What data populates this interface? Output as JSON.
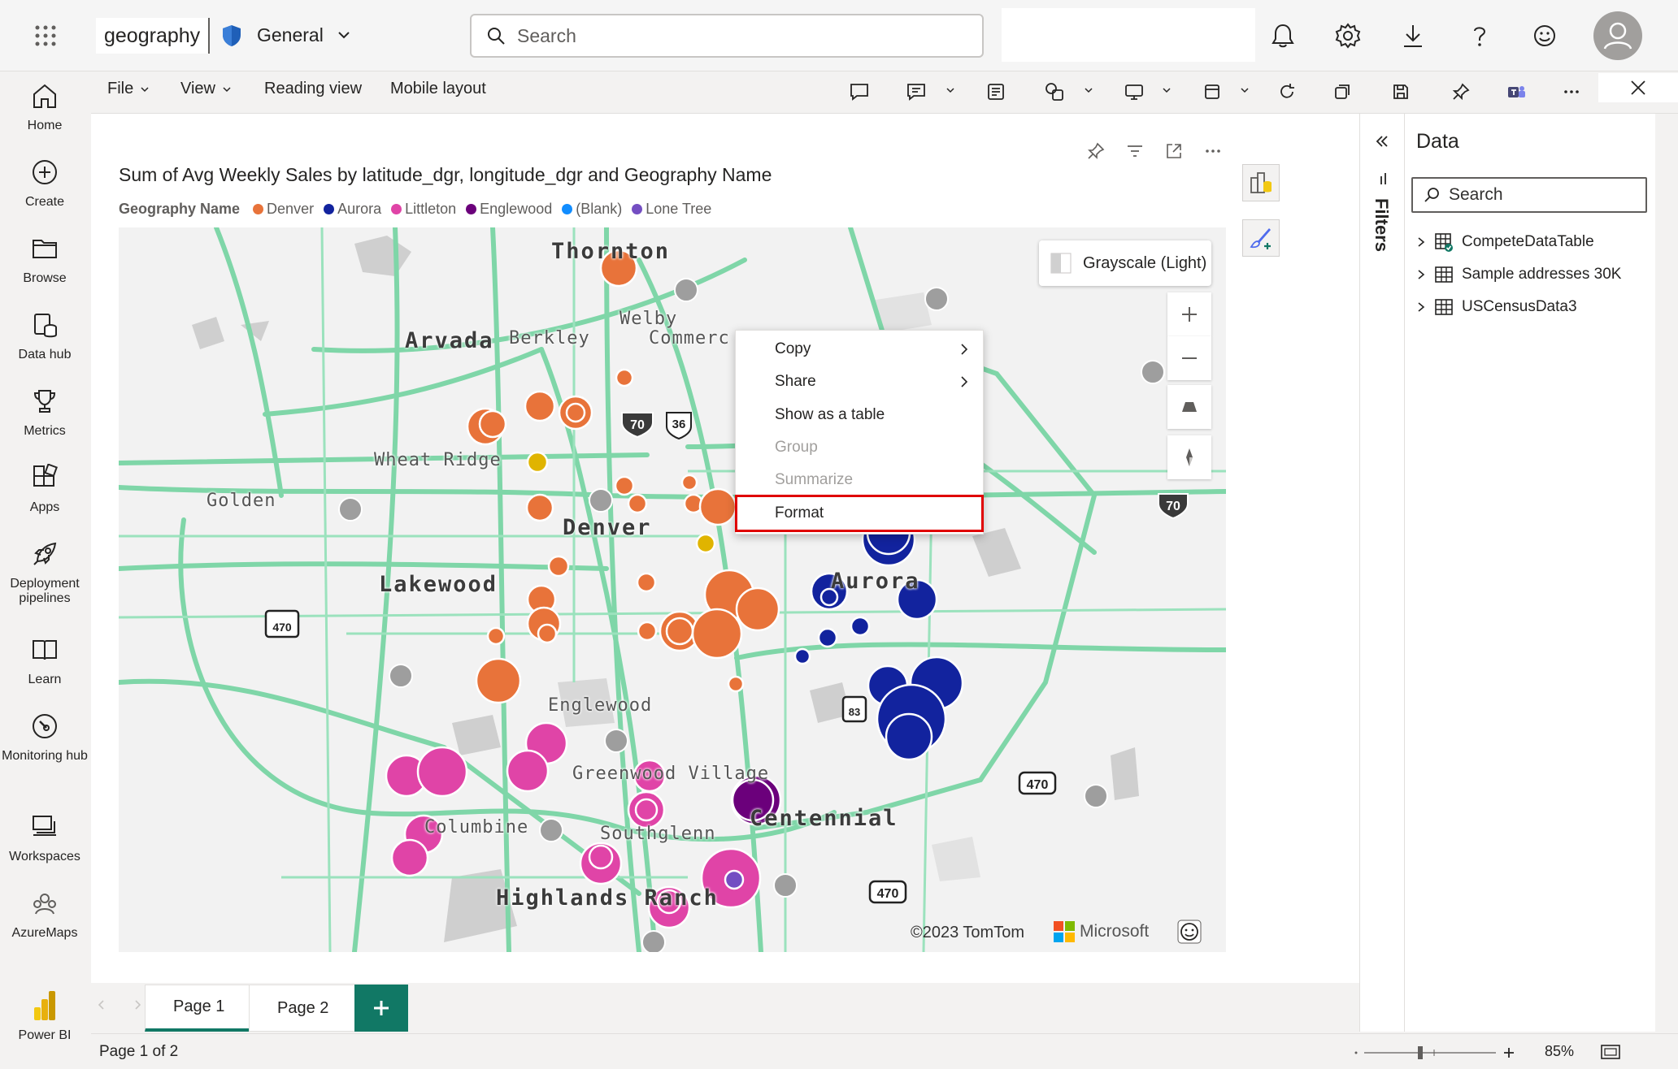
{
  "topbar": {
    "workspace_name": "geography",
    "sensitivity_label": "General",
    "search_placeholder": "Search"
  },
  "leftnav": [
    {
      "label": "Home",
      "icon": "home-icon"
    },
    {
      "label": "Create",
      "icon": "plus-circle-icon"
    },
    {
      "label": "Browse",
      "icon": "folder-icon"
    },
    {
      "label": "Data hub",
      "icon": "database-icon"
    },
    {
      "label": "Metrics",
      "icon": "trophy-icon"
    },
    {
      "label": "Apps",
      "icon": "apps-icon"
    },
    {
      "label": "Deployment pipelines",
      "icon": "rocket-icon"
    },
    {
      "label": "Learn",
      "icon": "book-icon"
    },
    {
      "label": "Monitoring hub",
      "icon": "gauge-icon"
    },
    {
      "label": "Workspaces",
      "icon": "workspaces-icon"
    },
    {
      "label": "AzureMaps",
      "icon": "azuremaps-icon"
    }
  ],
  "brand": {
    "label": "Power BI"
  },
  "ribbon": {
    "file": "File",
    "view": "View",
    "reading_view": "Reading view",
    "mobile_layout": "Mobile layout"
  },
  "visual": {
    "title": "Sum of Avg Weekly Sales by latitude_dgr, longitude_dgr and Geography Name",
    "legend_title": "Geography Name",
    "legend": [
      {
        "name": "Denver",
        "color": "#e8733a"
      },
      {
        "name": "Aurora",
        "color": "#12239e"
      },
      {
        "name": "Littleton",
        "color": "#e044a7"
      },
      {
        "name": "Englewood",
        "color": "#6b007b"
      },
      {
        "name": "(Blank)",
        "color": "#118dff"
      },
      {
        "name": "Lone Tree",
        "color": "#744ec2"
      }
    ]
  },
  "map": {
    "style_label": "Grayscale (Light)",
    "copyright": "©2023 TomTom",
    "brand": "Microsoft",
    "places": {
      "thornton": "Thornton",
      "welby": "Welby",
      "arvada": "Arvada",
      "berkley": "Berkley",
      "commerce": "Commerc",
      "wheat_ridge": "Wheat Ridge",
      "golden": "Golden",
      "denver": "Denver",
      "lakewood": "Lakewood",
      "aurora": "Aurora",
      "englewood": "Englewood",
      "greenwood": "Greenwood Village",
      "columbine": "Columbine",
      "southglenn": "Southglenn",
      "centennial": "Centennial",
      "highlands": "Highlands Ranch"
    },
    "shields": {
      "i70a": "70",
      "us36": "36",
      "i70b": "70",
      "s470a": "470",
      "s83": "83",
      "s470b": "470",
      "s470c": "470"
    }
  },
  "context_menu": {
    "items": [
      {
        "label": "Copy",
        "submenu": true,
        "disabled": false
      },
      {
        "label": "Share",
        "submenu": true,
        "disabled": false
      },
      {
        "label": "Show as a table",
        "submenu": false,
        "disabled": false
      },
      {
        "label": "Group",
        "submenu": false,
        "disabled": true
      },
      {
        "label": "Summarize",
        "submenu": false,
        "disabled": true
      },
      {
        "label": "Format",
        "submenu": false,
        "disabled": false
      }
    ]
  },
  "filters": {
    "label": "Filters"
  },
  "data_pane": {
    "title": "Data",
    "search_placeholder": "Search",
    "tables": [
      "CompeteDataTable",
      "Sample addresses 30K",
      "USCensusData3"
    ]
  },
  "pages": {
    "tabs": [
      "Page 1",
      "Page 2"
    ],
    "active": "Page 1"
  },
  "status": {
    "page_info": "Page 1 of 2",
    "zoom": "85%"
  }
}
